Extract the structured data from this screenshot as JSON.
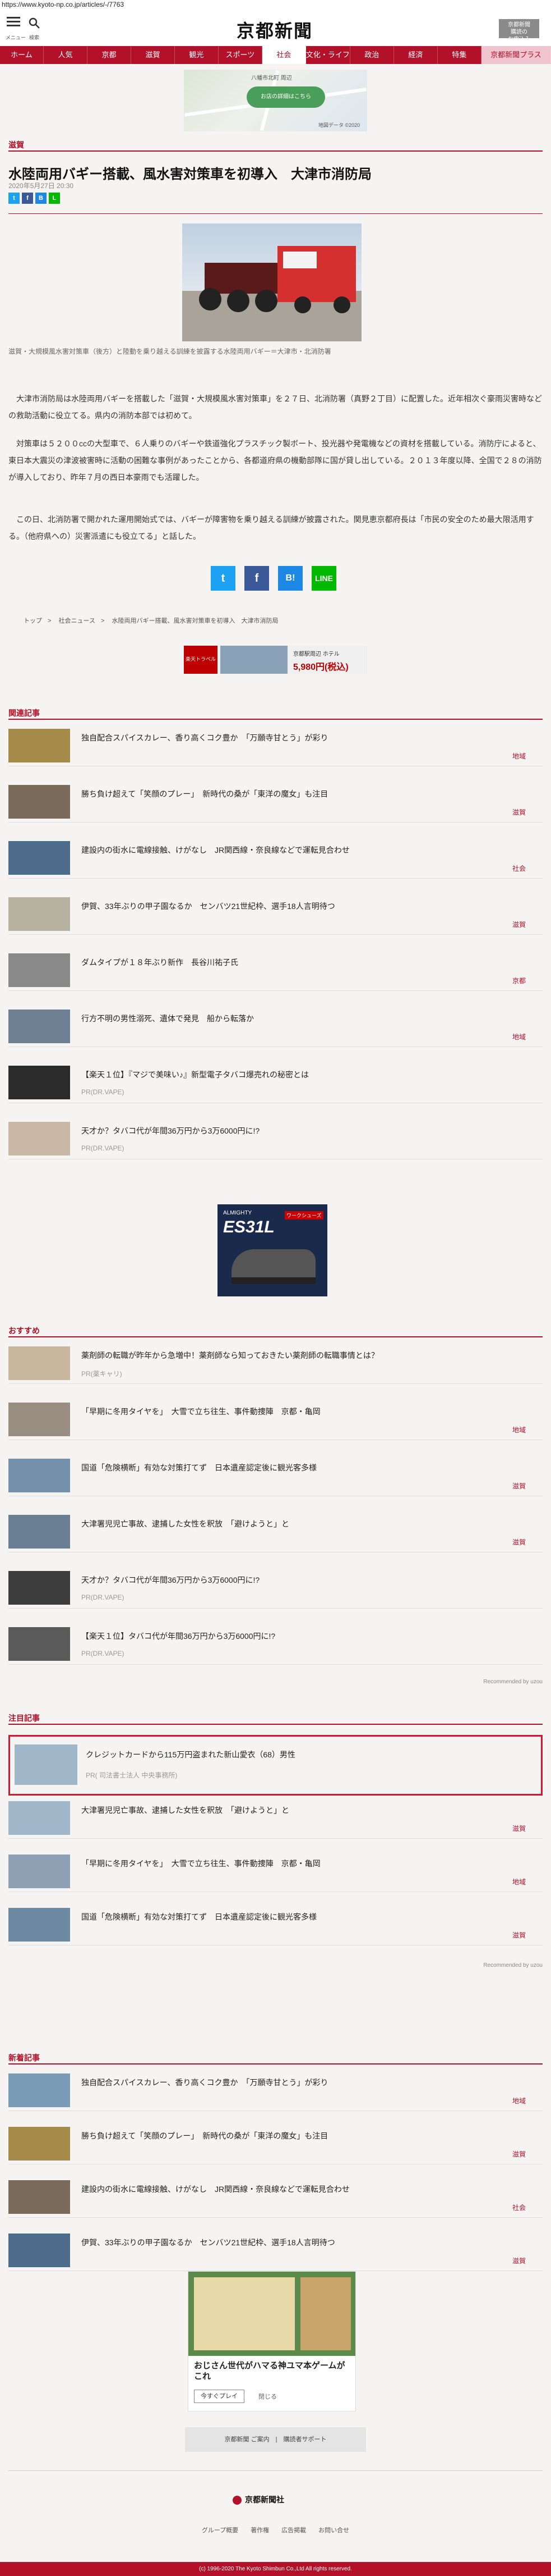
{
  "url": "https://www.kyoto-np.co.jp/articles/-/7763",
  "header": {
    "menu_label": "メニュー",
    "search_label": "検索",
    "logo": "京都新聞",
    "apply_label": "京都新聞\n購読の\nお申込み"
  },
  "nav": [
    "ホーム",
    "人気",
    "京都",
    "滋賀",
    "観光",
    "スポーツ",
    "社会",
    "文化・ライフ",
    "政治",
    "経済",
    "特集",
    "京都新聞プラス"
  ],
  "nav_active": "社会",
  "top_ad": {
    "button": "お店の詳細はこちら",
    "map_label": "八幡市北町 周辺",
    "map_credit": "地図データ ©2020"
  },
  "article": {
    "section": "滋賀",
    "title": "水陸両用バギー搭載、風水害対策車を初導入　大津市消防局",
    "date": "2020年5月27日 20:30",
    "caption": "滋賀・大規模風水害対策車（後方）と陸動を乗り越える訓練を披露する水陸両用バギー＝大津市・北消防署",
    "paragraphs": [
      "大津市消防局は水陸両用バギーを搭載した「滋賀・大規模風水害対策車」を２７日、北消防署（真野２丁目）に配置した。近年相次ぐ豪雨災害時などの救助活動に役立てる。県内の消防本部では初めて。",
      "対策車は５２００ccの大型車で、６人乗りのバギーや鉄道強化プラスチック製ボート、投光器や発電機などの資材を搭載している。消防庁によると、東日本大震災の津波被害時に活動の困難な事例があったことから、各都道府県の機動部隊に国が貸し出している。２０１３年度以降、全国で２８の消防が導入しており、昨年７月の西日本豪雨でも活躍した。",
      "この日、北消防署で開かれた運用開始式では、バギーが障害物を乗り越える訓練が披露された。関見恵京都府長は「市民の安全のため最大限活用する。（他府県への）災害派遣にも役立てる」と話した。"
    ]
  },
  "breadcrumbs": [
    "トップ",
    "社会ニュース",
    "水陸両用バギー搭載、風水害対策車を初導入　大津市消防局"
  ],
  "mid_ad": {
    "brand": "楽天トラベル",
    "headline": "京都駅周辺 ホテル",
    "price": "5,980円(税込)"
  },
  "related": {
    "label": "関連記事",
    "items": [
      {
        "title": "独自配合スパイスカレー、香り高くコク豊か　「万願寺甘とう」が彩り",
        "tag": "地域"
      },
      {
        "title": "勝ち負け超えて「笑顔のプレー」　新時代の桑が「東洋の魔女」も注目",
        "tag": "滋賀"
      },
      {
        "title": "建設内の街水に電線接触、けがなし　JR関西線・奈良線などで運転見合わせ",
        "tag": "社会"
      },
      {
        "title": "伊賀、33年ぶりの甲子園なるか　センバツ21世紀枠、選手18人言明待つ",
        "tag": "滋賀"
      },
      {
        "title": "ダムタイプが１８年ぶり新作　長谷川祐子氏",
        "tag": "京都"
      },
      {
        "title": "行方不明の男性溺死、遺体で発見　船から転落か",
        "tag": "地域"
      },
      {
        "title": "【楽天１位】『マジで美味い♪』新型電子タバコ爆売れの秘密とは",
        "sub": "PR(DR.VAPE)"
      },
      {
        "title": "天才か？タバコ代が年間36万円から3万6000円に!?",
        "sub": "PR(DR.VAPE)"
      }
    ]
  },
  "sky_ad": {
    "brand": "ALMIGHTY",
    "model": "ES31L",
    "label": "ワークシューズ"
  },
  "recommend": {
    "label": "おすすめ",
    "items": [
      {
        "title": "薬剤師の転職が昨年から急増中！薬剤師なら知っておきたい薬剤師の転職事情とは？",
        "sub": "PR(薬キャリ)"
      },
      {
        "title": "「早期に冬用タイヤを」　大雪で立ち往生、事件動捜陣　京都・亀岡",
        "tag": "地域"
      },
      {
        "title": "国道「危険横断」有効な対策打てず　日本遺産認定後に観光客多様",
        "tag": "滋賀"
      },
      {
        "title": "大津署児児亡事故、逮捕した女性を釈放　「避けようと」と",
        "tag": "滋賀"
      },
      {
        "title": "天才か？タバコ代が年間36万円から3万6000円に!?",
        "sub": "PR(DR.VAPE)"
      },
      {
        "title": "【楽天１位】タバコ代が年間36万円から3万6000円に!?",
        "sub": "PR(DR.VAPE)"
      }
    ],
    "credit": "Recommended by uzou"
  },
  "attention": {
    "label": "注目記事",
    "highlight": {
      "title": "クレジットカードから115万円盗まれた新山愛衣（68）男性",
      "sub": "PR( 司法書士法人 中央事務所)"
    },
    "items": [
      {
        "title": "大津署児児亡事故、逮捕した女性を釈放　「避けようと」と",
        "tag": "滋賀"
      },
      {
        "title": "「早期に冬用タイヤを」　大雪で立ち往生、事件動捜陣　京都・亀岡",
        "tag": "地域"
      },
      {
        "title": "国道「危険横断」有効な対策打てず　日本遺産認定後に観光客多様",
        "tag": "滋賀"
      }
    ],
    "credit": "Recommended by uzou"
  },
  "newest": {
    "label": "新着記事",
    "items": [
      {
        "title": "独自配合スパイスカレー、香り高くコク豊か　「万願寺甘とう」が彩り",
        "tag": "地域"
      },
      {
        "title": "勝ち負け超えて「笑顔のプレー」　新時代の桑が「東洋の魔女」も注目",
        "tag": "滋賀"
      },
      {
        "title": "建設内の街水に電線接触、けがなし　JR関西線・奈良線などで運転見合わせ",
        "tag": "社会"
      },
      {
        "title": "伊賀、33年ぶりの甲子園なるか　センバツ21世紀枠、選手18人言明待つ",
        "tag": "滋賀"
      }
    ]
  },
  "bottom_ad": {
    "headline": "おじさん世代がハマる神ユマ本ゲームがこれ",
    "button": "今すぐプレイ",
    "close": "閉じる"
  },
  "footer": {
    "links": "京都新聞 ご案内　|　購読者サポート",
    "logo": "京都新聞社",
    "nav": "グループ概要　　著作権　　広告掲載　　お問い合せ",
    "copyright": "(c) 1996-2020 The Kyoto Shimbun Co.,Ltd All rights reserved."
  },
  "colors": {
    "brand": "#b3112a",
    "highlight_border": "#d1182e"
  }
}
